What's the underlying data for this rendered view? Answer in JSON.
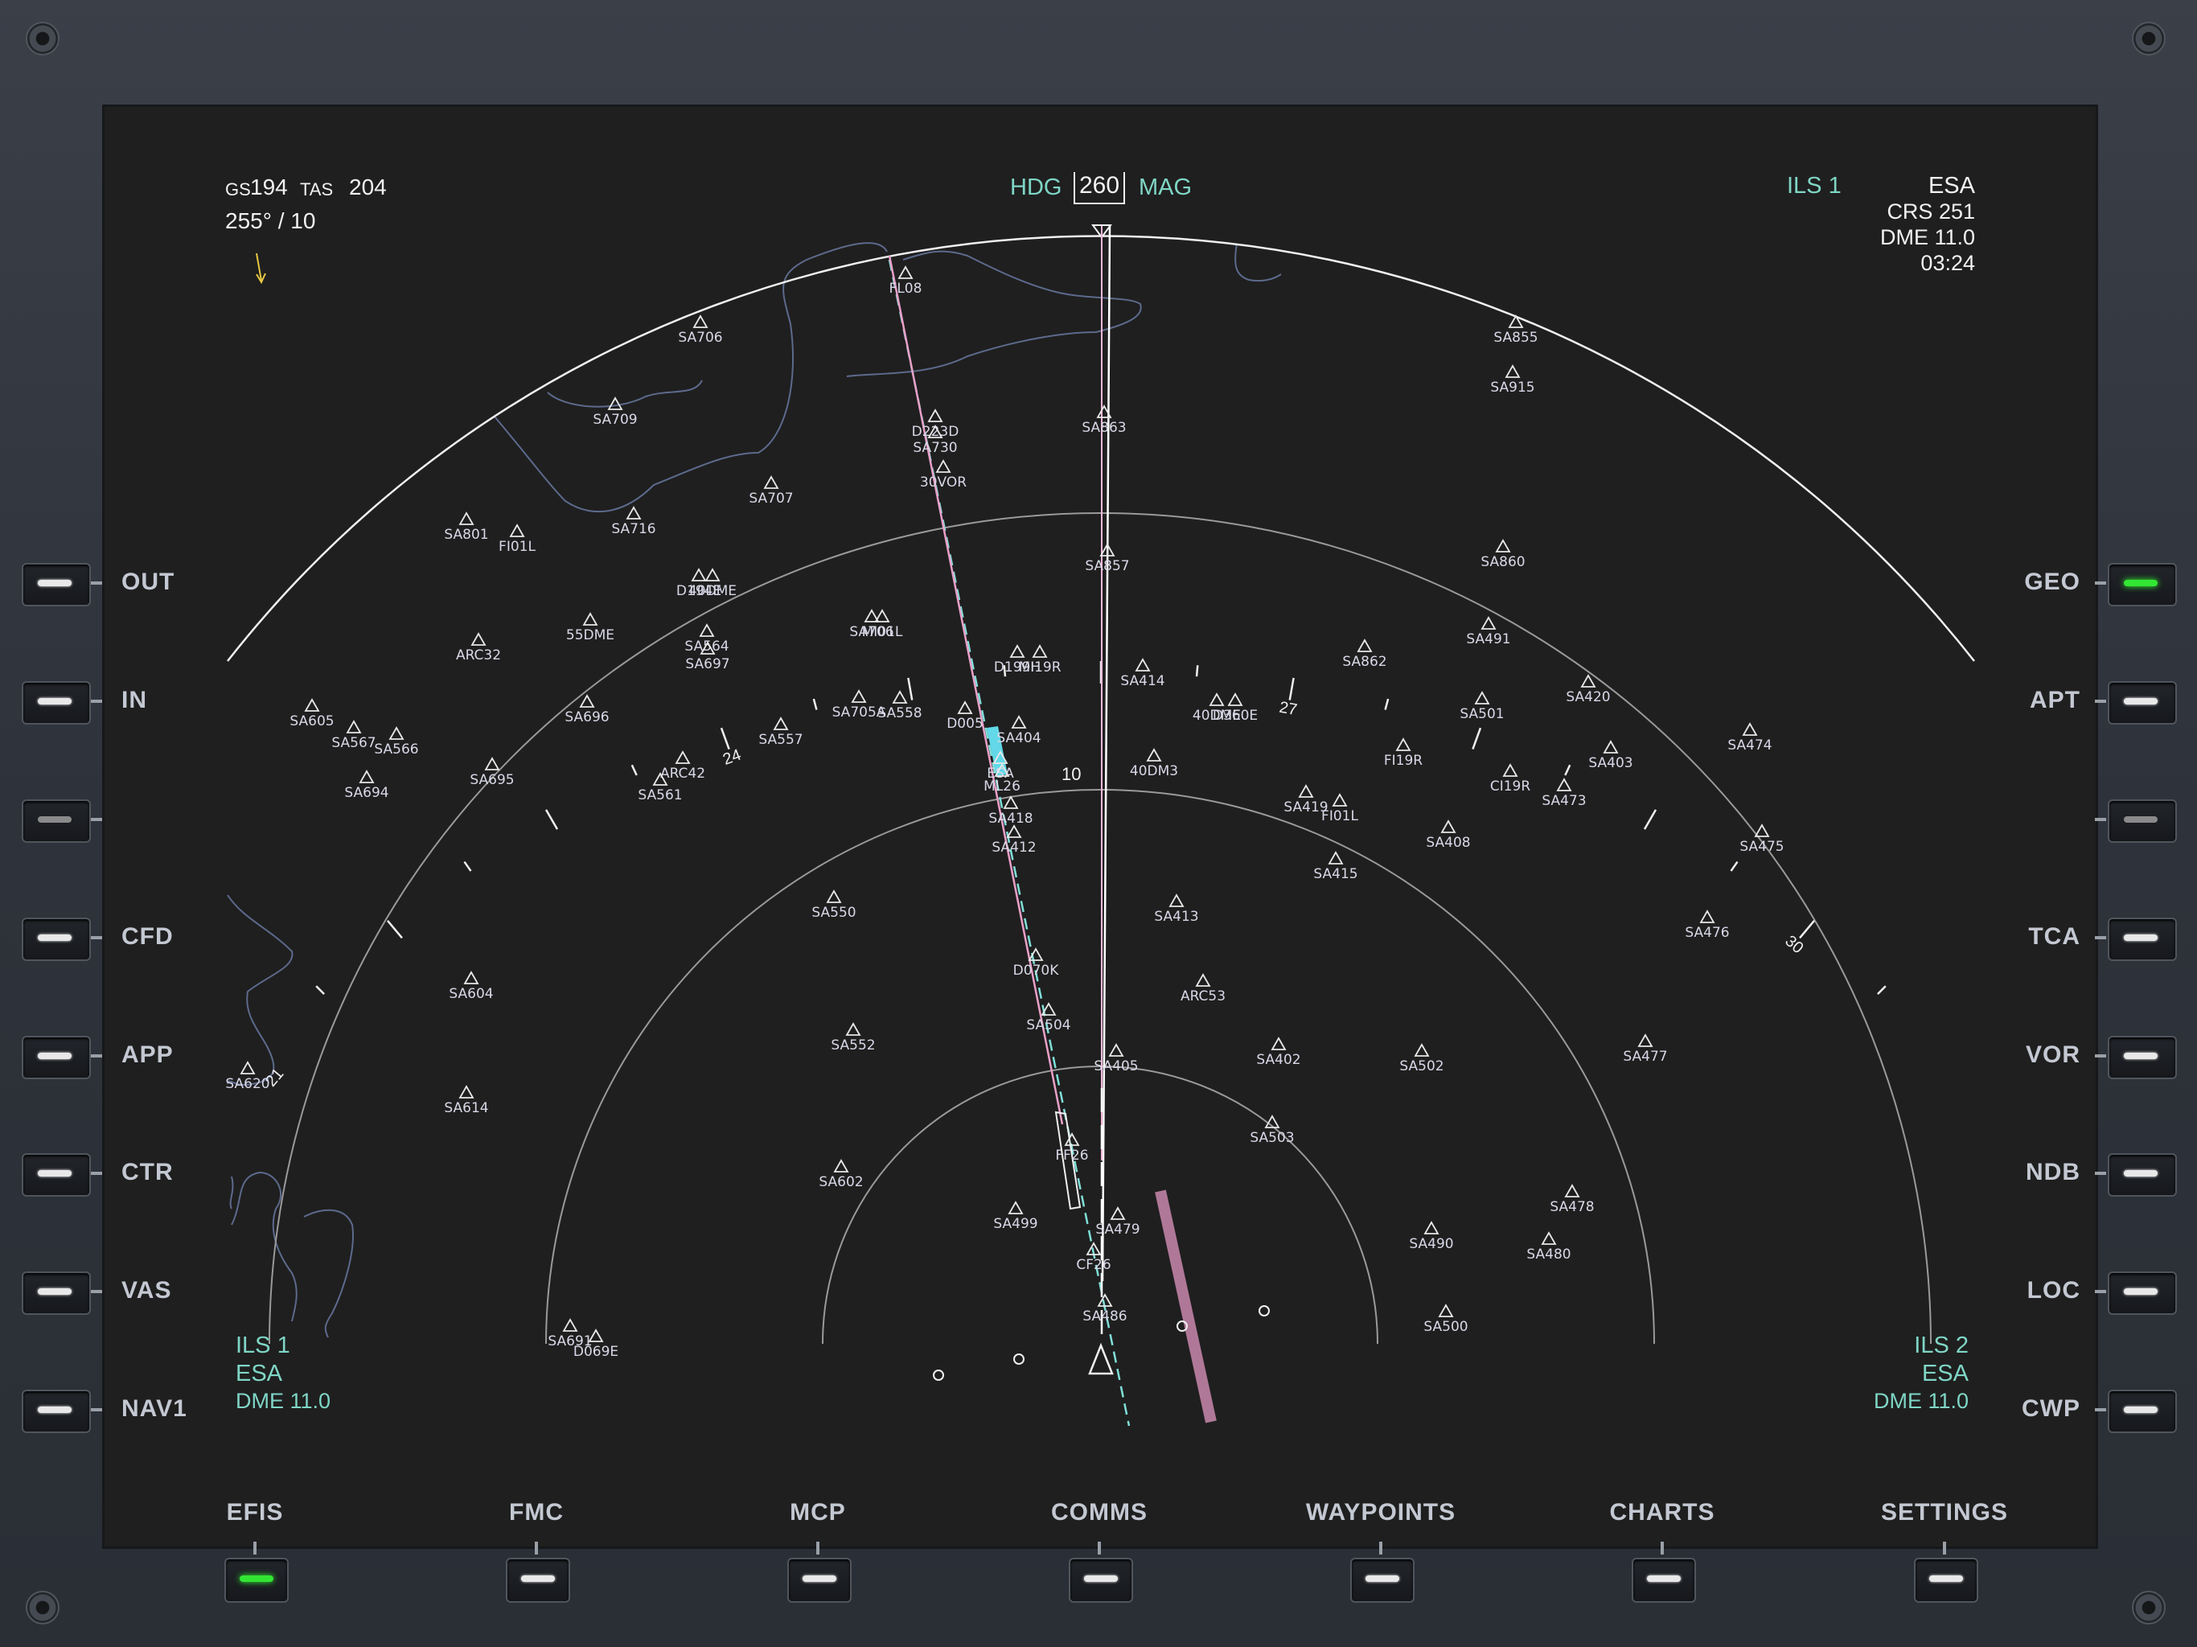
{
  "header": {
    "gs_label": "GS",
    "gs_value": "194",
    "tas_label": "TAS",
    "tas_value": "204",
    "wind": "255° /  10",
    "hdg_label": "HDG",
    "hdg_value": "260",
    "mag_label": "MAG",
    "nav_source": "ILS 1",
    "nav_ident": "ESA",
    "crs": "CRS 251",
    "dme": "DME 11.0",
    "time": "03:24"
  },
  "compass": {
    "labels": [
      "21",
      "24",
      "27",
      "30"
    ]
  },
  "range_label": "10",
  "left_nav": {
    "source": "ILS 1",
    "ident": "ESA",
    "dme": "DME 11.0"
  },
  "right_nav": {
    "source": "ILS 2",
    "ident": "ESA",
    "dme": "DME 11.0"
  },
  "waypoints": [
    {
      "id": "FL08"
    },
    {
      "id": "SA706"
    },
    {
      "id": "SA709"
    },
    {
      "id": "SA707"
    },
    {
      "id": "D223D"
    },
    {
      "id": "SA730"
    },
    {
      "id": "30VOR"
    },
    {
      "id": "SA863"
    },
    {
      "id": "SA857"
    },
    {
      "id": "SA855"
    },
    {
      "id": "SA915"
    },
    {
      "id": "SA860"
    },
    {
      "id": "SA801"
    },
    {
      "id": "FI01L"
    },
    {
      "id": "SA716"
    },
    {
      "id": "D194E"
    },
    {
      "id": "40DME"
    },
    {
      "id": "55DME"
    },
    {
      "id": "ARC32"
    },
    {
      "id": "SA564"
    },
    {
      "id": "SA697"
    },
    {
      "id": "SA706"
    },
    {
      "id": "MI01L"
    },
    {
      "id": "D199H"
    },
    {
      "id": "MI19R"
    },
    {
      "id": "SA414"
    },
    {
      "id": "SA862"
    },
    {
      "id": "SA491"
    },
    {
      "id": "SA605"
    },
    {
      "id": "SA567"
    },
    {
      "id": "SA566"
    },
    {
      "id": "SA696"
    },
    {
      "id": "SA705A"
    },
    {
      "id": "SA558"
    },
    {
      "id": "D005"
    },
    {
      "id": "SA404"
    },
    {
      "id": "40DME"
    },
    {
      "id": "D360E"
    },
    {
      "id": "SA501"
    },
    {
      "id": "SA420"
    },
    {
      "id": "SA474"
    },
    {
      "id": "SA694"
    },
    {
      "id": "SA695"
    },
    {
      "id": "ARC42"
    },
    {
      "id": "SA561"
    },
    {
      "id": "SA557"
    },
    {
      "id": "ESA"
    },
    {
      "id": "ML26"
    },
    {
      "id": "40DM3"
    },
    {
      "id": "FI19R"
    },
    {
      "id": "CI19R"
    },
    {
      "id": "SA403"
    },
    {
      "id": "SA473"
    },
    {
      "id": "SA418"
    },
    {
      "id": "SA419"
    },
    {
      "id": "FI01L"
    },
    {
      "id": "SA408"
    },
    {
      "id": "SA412"
    },
    {
      "id": "SA475"
    },
    {
      "id": "SA415"
    },
    {
      "id": "SA550"
    },
    {
      "id": "SA413"
    },
    {
      "id": "SA476"
    },
    {
      "id": "D070K"
    },
    {
      "id": "SA604"
    },
    {
      "id": "ARC53"
    },
    {
      "id": "SA504"
    },
    {
      "id": "SA552"
    },
    {
      "id": "SA405"
    },
    {
      "id": "SA402"
    },
    {
      "id": "SA502"
    },
    {
      "id": "SA477"
    },
    {
      "id": "SA620"
    },
    {
      "id": "SA614"
    },
    {
      "id": "SA503"
    },
    {
      "id": "FF26"
    },
    {
      "id": "SA602"
    },
    {
      "id": "SA478"
    },
    {
      "id": "SA499"
    },
    {
      "id": "SA479"
    },
    {
      "id": "SA490"
    },
    {
      "id": "SA480"
    },
    {
      "id": "CF26"
    },
    {
      "id": "SA486"
    },
    {
      "id": "SA500"
    },
    {
      "id": "SA691"
    },
    {
      "id": "D069E"
    }
  ],
  "side_buttons_left": [
    {
      "label": "OUT",
      "led": "on"
    },
    {
      "label": "IN",
      "led": "on"
    },
    {
      "label": "",
      "led": "dim"
    },
    {
      "label": "CFD",
      "led": "on"
    },
    {
      "label": "APP",
      "led": "on"
    },
    {
      "label": "CTR",
      "led": "on"
    },
    {
      "label": "VAS",
      "led": "on"
    },
    {
      "label": "NAV1",
      "led": "on"
    }
  ],
  "side_buttons_right": [
    {
      "label": "GEO",
      "led": "green"
    },
    {
      "label": "APT",
      "led": "on"
    },
    {
      "label": "",
      "led": "dim"
    },
    {
      "label": "TCA",
      "led": "on"
    },
    {
      "label": "VOR",
      "led": "on"
    },
    {
      "label": "NDB",
      "led": "on"
    },
    {
      "label": "LOC",
      "led": "on"
    },
    {
      "label": "CWP",
      "led": "on"
    }
  ],
  "bottom_tabs": [
    {
      "label": "EFIS",
      "led": "green"
    },
    {
      "label": "FMC",
      "led": "on"
    },
    {
      "label": "MCP",
      "led": "on"
    },
    {
      "label": "COMMS",
      "led": "on"
    },
    {
      "label": "WAYPOINTS",
      "led": "on"
    },
    {
      "label": "CHARTS",
      "led": "on"
    },
    {
      "label": "SETTINGS",
      "led": "on"
    }
  ],
  "colors": {
    "cyan_text": "#7fd6c6",
    "magenta_route": "#e8a0c8",
    "localizer": "#7fe0d8",
    "bezel": "#2c3038",
    "display_bg": "#1f1f1f",
    "active_led": "#33e633"
  }
}
